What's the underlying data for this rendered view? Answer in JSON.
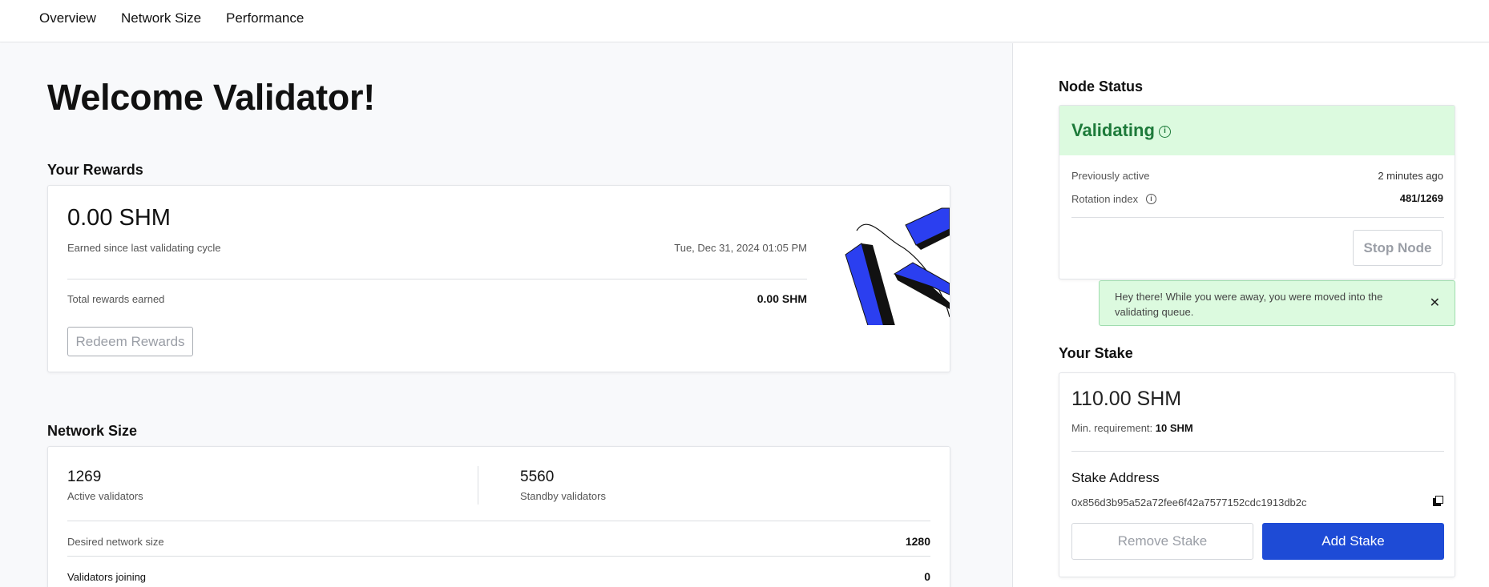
{
  "nav": {
    "tabs": [
      "Overview",
      "Network Size",
      "Performance"
    ]
  },
  "welcome": "Welcome Validator!",
  "rewards": {
    "title": "Your Rewards",
    "amount": "0.00 SHM",
    "earned_label": "Earned since last validating cycle",
    "timestamp": "Tue, Dec 31, 2024 01:05 PM",
    "total_label": "Total rewards earned",
    "total_value": "0.00 SHM",
    "redeem_label": "Redeem Rewards"
  },
  "network": {
    "title": "Network Size",
    "active_count": "1269",
    "active_label": "Active validators",
    "standby_count": "5560",
    "standby_label": "Standby validators",
    "desired_label": "Desired network size",
    "desired_value": "1280",
    "joining_label": "Validators joining",
    "joining_value": "0"
  },
  "node_status": {
    "title": "Node Status",
    "status": "Validating",
    "prev_active_label": "Previously active",
    "prev_active_value": "2 minutes ago",
    "rotation_label": "Rotation index",
    "rotation_value": "481/1269",
    "stop_label": "Stop Node"
  },
  "toast": {
    "message": "Hey there! While you were away, you were moved into the validating queue."
  },
  "stake": {
    "title": "Your Stake",
    "amount": "110.00 SHM",
    "min_label": "Min. requirement:",
    "min_value": "10 SHM",
    "address_title": "Stake Address",
    "address": "0x856d3b95a52a72fee6f42a7577152cdc1913db2c",
    "remove_label": "Remove Stake",
    "add_label": "Add Stake"
  },
  "colors": {
    "accent": "#1e4bd6",
    "status_green": "#1d7a3a",
    "status_bg": "#dcfadf",
    "illustration_blue": "#2b3ff0"
  },
  "icons": [
    "info-icon",
    "close-icon",
    "copy-icon"
  ]
}
